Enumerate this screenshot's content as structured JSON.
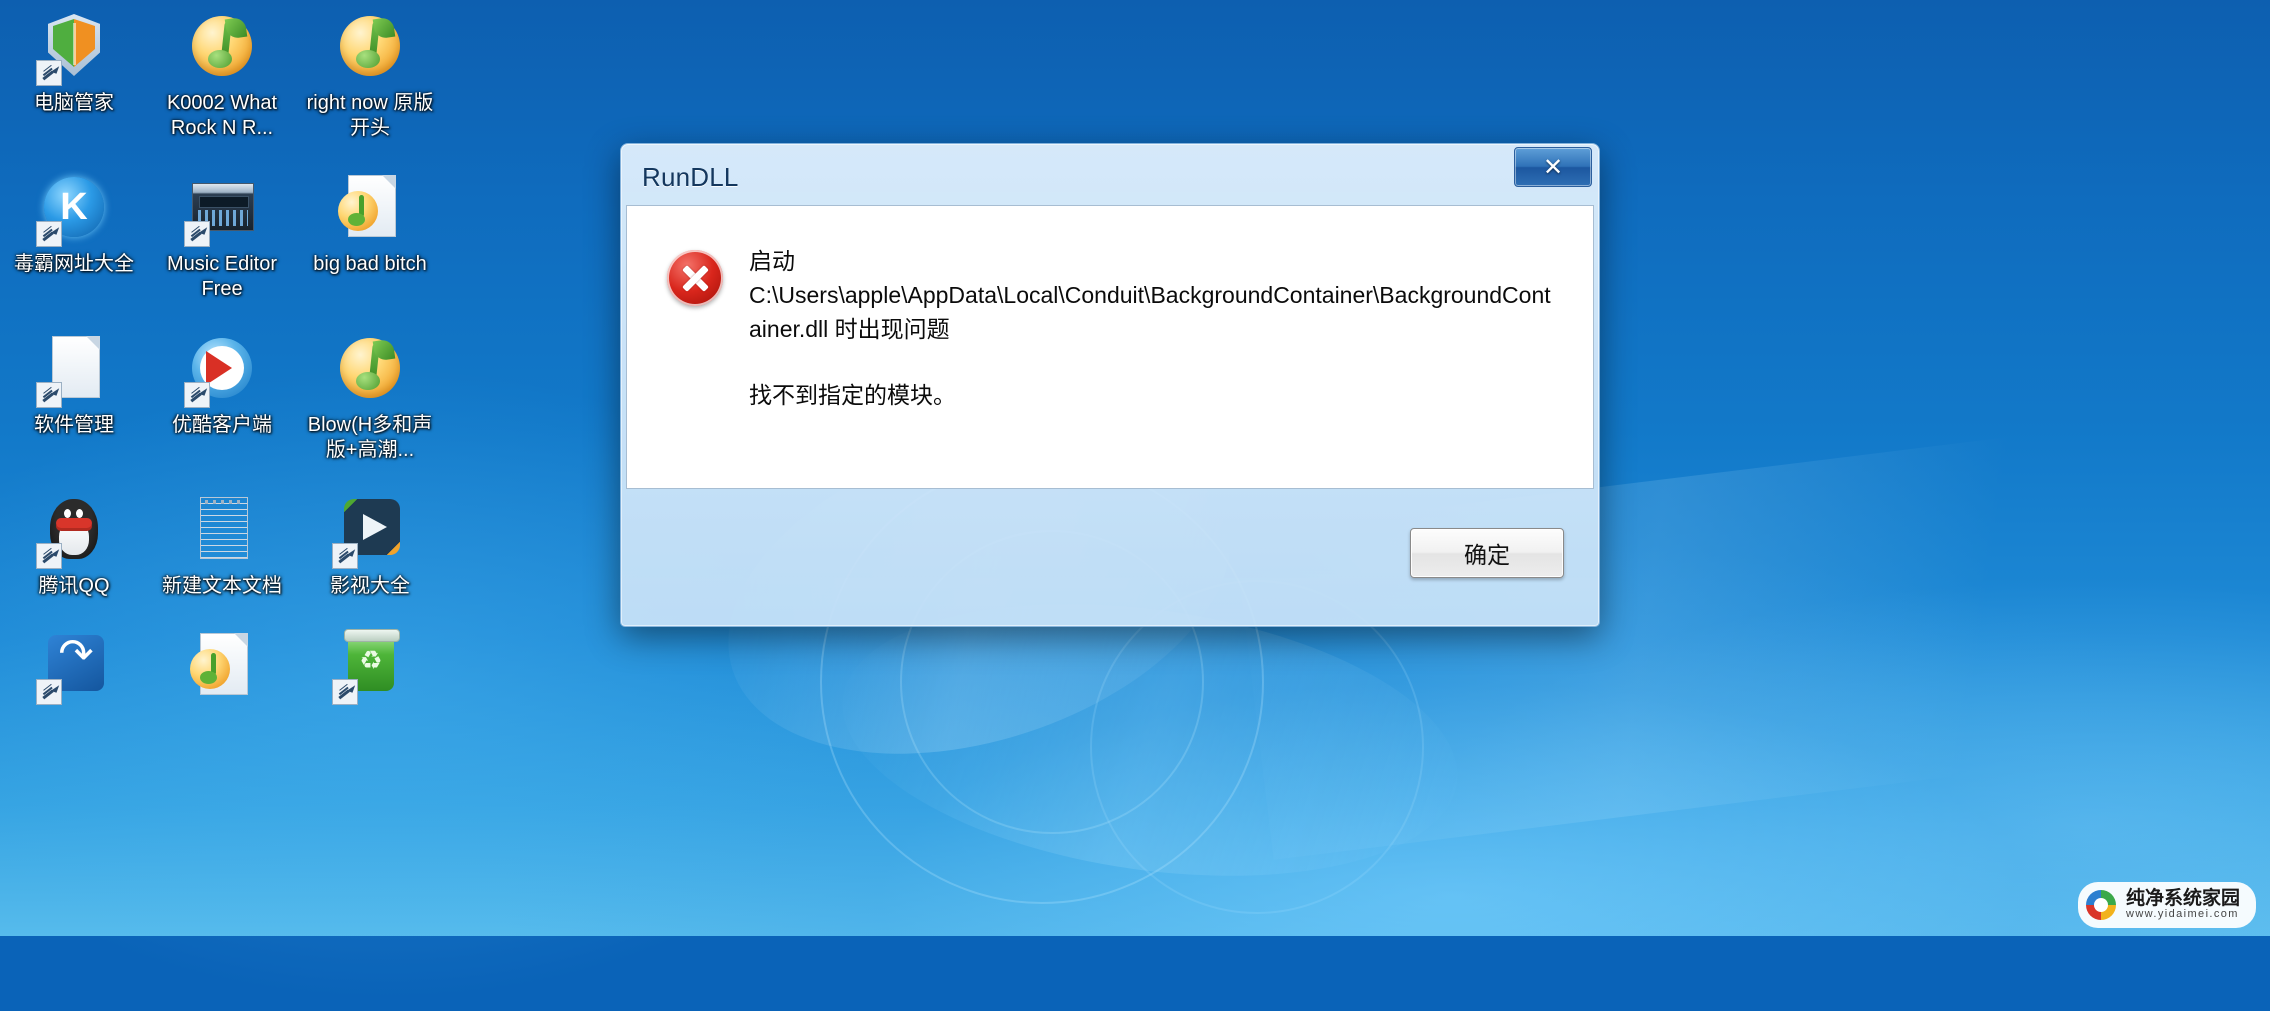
{
  "desktop": {
    "icons": [
      {
        "label": "电脑管家",
        "art": "shield",
        "shortcut": true
      },
      {
        "label": "K0002 What Rock N R...",
        "art": "note",
        "shortcut": false
      },
      {
        "label": "right now 原版开头",
        "art": "note",
        "shortcut": false
      },
      {
        "label": "毒霸网址大全",
        "art": "kcircle",
        "glyph": "K",
        "shortcut": true
      },
      {
        "label": "Music Editor Free",
        "art": "mixer",
        "shortcut": true
      },
      {
        "label": "big bad bitch",
        "art": "page-note",
        "shortcut": false
      },
      {
        "label": "软件管理",
        "art": "page",
        "shortcut": true
      },
      {
        "label": "优酷客户端",
        "art": "youku",
        "shortcut": true
      },
      {
        "label": "Blow(H多和声版+高潮...",
        "art": "note",
        "shortcut": false
      },
      {
        "label": "腾讯QQ",
        "art": "penguin",
        "shortcut": true
      },
      {
        "label": "新建文本文档",
        "art": "notepad",
        "shortcut": false
      },
      {
        "label": "影视大全",
        "art": "play",
        "shortcut": true
      },
      {
        "label": "",
        "art": "arrows",
        "shortcut": true
      },
      {
        "label": "",
        "art": "page-note",
        "shortcut": false
      },
      {
        "label": "",
        "art": "bin",
        "shortcut": true
      }
    ]
  },
  "dialog": {
    "title": "RunDLL",
    "close_label": "✕",
    "error_icon": "error-x-icon",
    "message_primary": "启动 C:\\Users\\apple\\AppData\\Local\\Conduit\\BackgroundContainer\\BackgroundContainer.dll 时出现问题",
    "message_line_1": "启动",
    "message_line_2": "C:\\Users\\apple\\AppData\\Local\\Conduit\\BackgroundContainer\\BackgroundContainer.dll 时出现问题",
    "message_secondary": "找不到指定的模块。",
    "ok_label": "确定"
  },
  "watermark": {
    "title": "纯净系统家园",
    "url": "www.yidaimei.com"
  },
  "colors": {
    "desktop_blue": "#1279c9",
    "title_text": "#14375e",
    "error_red": "#d9261c",
    "dialog_face": "#dceefc"
  }
}
